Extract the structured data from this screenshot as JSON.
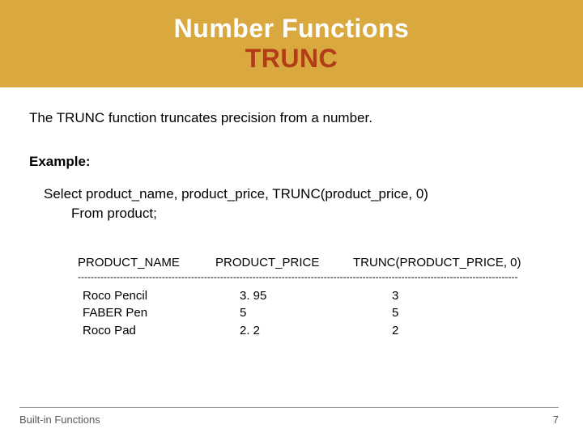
{
  "title": {
    "line1": "Number Functions",
    "line2": "TRUNC"
  },
  "description": "The TRUNC function truncates precision from a number.",
  "example_label": "Example:",
  "sql": {
    "line1": "Select  product_name, product_price, TRUNC(product_price, 0)",
    "line2": "From product;"
  },
  "table": {
    "headers": {
      "c1": "PRODUCT_NAME",
      "c2": "PRODUCT_PRICE",
      "c3": "TRUNC(PRODUCT_PRICE, 0)"
    },
    "divider": "----------------------------------------------------------------------------------------------------------------------------------------",
    "rows": [
      {
        "c1": "Roco Pencil",
        "c2": "3. 95",
        "c3": "3"
      },
      {
        "c1": "FABER Pen",
        "c2": "5",
        "c3": "5"
      },
      {
        "c1": "Roco Pad",
        "c2": "2. 2",
        "c3": "2"
      }
    ]
  },
  "footer": {
    "left": "Built-in Functions",
    "right": "7"
  },
  "chart_data": {
    "type": "table",
    "title": "TRUNC function example output",
    "columns": [
      "PRODUCT_NAME",
      "PRODUCT_PRICE",
      "TRUNC(PRODUCT_PRICE, 0)"
    ],
    "rows": [
      [
        "Roco Pencil",
        3.95,
        3
      ],
      [
        "FABER Pen",
        5,
        5
      ],
      [
        "Roco Pad",
        2.2,
        2
      ]
    ]
  }
}
